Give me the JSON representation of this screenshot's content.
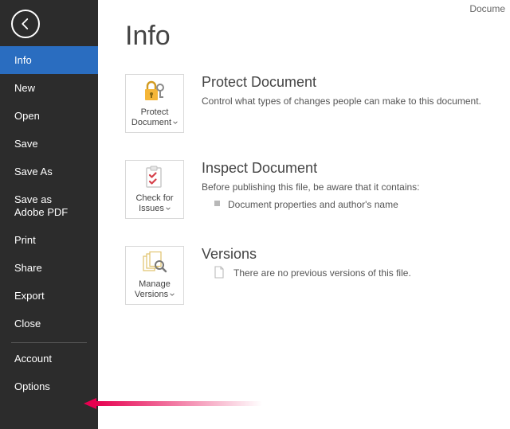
{
  "topRight": "Docume",
  "sidebar": {
    "items": [
      {
        "label": "Info",
        "selected": true
      },
      {
        "label": "New"
      },
      {
        "label": "Open"
      },
      {
        "label": "Save"
      },
      {
        "label": "Save As"
      },
      {
        "label": "Save as Adobe PDF"
      },
      {
        "label": "Print"
      },
      {
        "label": "Share"
      },
      {
        "label": "Export"
      },
      {
        "label": "Close"
      }
    ],
    "footerItems": [
      {
        "label": "Account"
      },
      {
        "label": "Options"
      }
    ]
  },
  "main": {
    "title": "Info",
    "sections": {
      "protect": {
        "button": "Protect Document",
        "title": "Protect Document",
        "desc": "Control what types of changes people can make to this document."
      },
      "inspect": {
        "button": "Check for Issues",
        "title": "Inspect Document",
        "desc": "Before publishing this file, be aware that it contains:",
        "bullet": "Document properties and author's name"
      },
      "versions": {
        "button": "Manage Versions",
        "title": "Versions",
        "desc": "There are no previous versions of this file."
      }
    }
  }
}
